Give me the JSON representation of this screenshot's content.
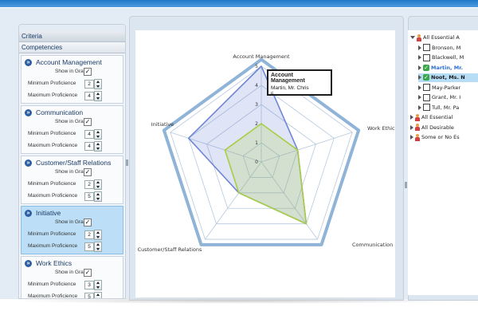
{
  "left": {
    "criteria_label": "Criteria",
    "competencies_label": "Competencies",
    "show_label": "Show in Graph",
    "min_label": "Minimum Proficience",
    "max_label": "Maximum Proficience",
    "items": [
      {
        "title": "Account Management",
        "show": "✓",
        "min": "2",
        "max": "4"
      },
      {
        "title": "Communication",
        "show": "✓",
        "min": "4",
        "max": "4"
      },
      {
        "title": "Customer/Staff Relations",
        "show": "✓",
        "min": "2",
        "max": "5"
      },
      {
        "title": "Initiative",
        "show": "✓",
        "min": "2",
        "max": "5"
      },
      {
        "title": "Work Ethics",
        "show": "✓",
        "min": "3",
        "max": "5"
      }
    ]
  },
  "chart_data": {
    "type": "radar",
    "axes": [
      "Account Management",
      "Work Ethics",
      "Communication",
      "Customer/Staff Relations",
      "Initiative"
    ],
    "range": [
      0,
      5
    ],
    "ticks": [
      "0",
      "1",
      "2",
      "3",
      "4",
      "5"
    ],
    "series": [
      {
        "values": [
          5,
          5,
          5,
          5,
          5
        ],
        "color": "#8fb4d8"
      },
      {
        "values": [
          5,
          2,
          4,
          2,
          4
        ],
        "color": "#6e86d6"
      },
      {
        "values": [
          2,
          2,
          4,
          2,
          2
        ],
        "color": "#a9cd45"
      }
    ]
  },
  "tooltip": {
    "title": "Account Management",
    "name": "Martin, Mr. Chris",
    "value": "5"
  },
  "tree": {
    "nodes": [
      {
        "label": "All Essential A",
        "kind": "group-open",
        "indent": 0
      },
      {
        "label": "Bronson, M",
        "kind": "check",
        "indent": 1
      },
      {
        "label": "Blackwell, M",
        "kind": "check",
        "indent": 1
      },
      {
        "label": "Martin, Mr.",
        "kind": "checked-hl",
        "indent": 1
      },
      {
        "label": "Noot, Ms. N",
        "kind": "checked-sel",
        "indent": 1
      },
      {
        "label": "May-Parker",
        "kind": "check",
        "indent": 1
      },
      {
        "label": "Grant, Mr. I",
        "kind": "check",
        "indent": 1
      },
      {
        "label": "Tull, Mr. Pa",
        "kind": "check",
        "indent": 1
      },
      {
        "label": "All Essential",
        "kind": "group",
        "indent": 0
      },
      {
        "label": "All Desirable",
        "kind": "group",
        "indent": 0
      },
      {
        "label": "Some or No Es",
        "kind": "group",
        "indent": 0
      }
    ]
  }
}
